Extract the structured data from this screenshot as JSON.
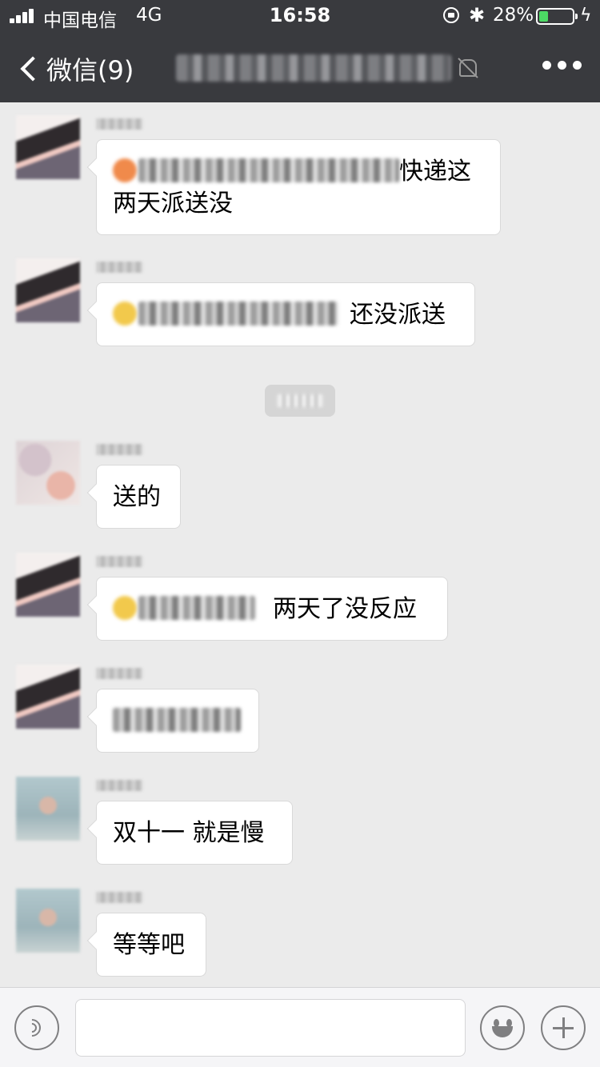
{
  "status_bar": {
    "carrier": "中国电信",
    "network": "4G",
    "time": "16:58",
    "battery": "28%",
    "battery_level": 0.28,
    "icons": [
      "signal-icon",
      "rotation-lock-icon",
      "bluetooth-icon",
      "battery-icon",
      "charging-icon"
    ]
  },
  "nav": {
    "back_label": "微信(9)",
    "more_icon": "more-icon",
    "muted_icon": "mute-icon"
  },
  "messages": [
    {
      "avatar": "a",
      "text": "快递这两天派送没",
      "prefix": "orange"
    },
    {
      "avatar": "a",
      "text": "还没派送",
      "prefix": "yellow"
    },
    {
      "avatar": "b",
      "text": "送的"
    },
    {
      "avatar": "a",
      "text": "两天了没反应",
      "prefix": "yellow"
    },
    {
      "avatar": "a",
      "text": ""
    },
    {
      "avatar": "c",
      "text": "双十一 就是慢"
    },
    {
      "avatar": "c",
      "text": "等等吧"
    }
  ],
  "input_bar": {
    "voice_icon": "voice-icon",
    "emoji_icon": "emoji-icon",
    "plus_icon": "plus-icon"
  },
  "colors": {
    "nav_bg": "#393a3e",
    "chat_bg": "#ebebeb",
    "bubble_bg": "#ffffff",
    "battery_green": "#4cd964"
  }
}
